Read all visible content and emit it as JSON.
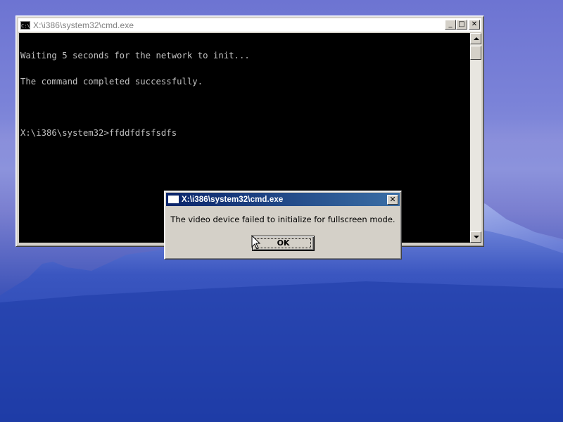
{
  "desktop": {
    "sky_color": "#7b83d8",
    "mountain_color": "#2a48b0"
  },
  "cmd_window": {
    "title": "X:\\i386\\system32\\cmd.exe",
    "icon": "cmd-icon",
    "icon_text": "C:\\",
    "buttons": {
      "minimize": "_",
      "maximize": "□",
      "close": "✕"
    },
    "console_lines": [
      "Waiting 5 seconds for the network to init...",
      "The command completed successfully.",
      "",
      "X:\\i386\\system32>ffddfdfsfsdfs"
    ]
  },
  "dialog": {
    "title": "X:\\i386\\system32\\cmd.exe",
    "message": "The video device failed to initialize for fullscreen mode.",
    "ok_label": "OK",
    "close_label": "✕"
  }
}
